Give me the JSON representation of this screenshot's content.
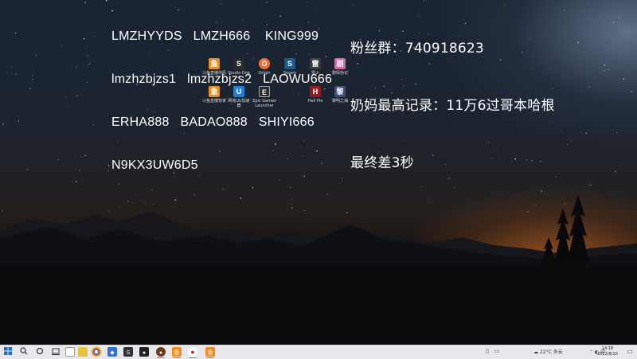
{
  "overlay": {
    "codes_lines": [
      "LMZHYYDS   LMZH666    KING999",
      "lmzhzbjzs1   lmzhzbjzs2   LAOWU666",
      "ERHA888   BADAO888   SHIYI666",
      "N9KX3UW6D5"
    ],
    "fan_group": "粉丝群：740918623",
    "record_line1": "奶妈最高记录：11万6过哥本哈根",
    "record_line2": "最终差3秒"
  },
  "desktop_icons": [
    {
      "label": "斗鱼直播伴侣",
      "icon": "douyu-icon",
      "color": "#f08c1e",
      "glyph": "鱼"
    },
    {
      "label": "Studio One 4",
      "icon": "studio-one-icon",
      "color": "#2b2b2b",
      "glyph": "S"
    },
    {
      "label": "Origin",
      "icon": "origin-icon",
      "color": "#f56c2d",
      "glyph": "O"
    },
    {
      "label": "Steam",
      "icon": "steam-icon",
      "color": "#1b5a8a",
      "glyph": "S"
    },
    {
      "label": "雷火",
      "icon": "leihuo-icon",
      "color": "#3a3a3a",
      "glyph": "雷"
    },
    {
      "label": "剧情伪记",
      "icon": "game-icon",
      "color": "#d46ba0",
      "glyph": "剧"
    },
    {
      "label": "斗鱼直播管家",
      "icon": "douyu-manager-icon",
      "color": "#f08c1e",
      "glyph": "鱼"
    },
    {
      "label": "网易UU加速器",
      "icon": "uu-accelerator-icon",
      "color": "#1e7fd6",
      "glyph": "U"
    },
    {
      "label": "Epic Games Launcher",
      "icon": "epic-games-icon",
      "color": "#2a2a2a",
      "glyph": "E"
    },
    {
      "label": "Hell Pie",
      "icon": "hell-pie-icon",
      "color": "#8a1f1f",
      "glyph": "H"
    },
    {
      "label": "黎明之海",
      "icon": "sea-of-dawn-icon",
      "color": "#3d4f7a",
      "glyph": "黎"
    }
  ],
  "taskbar": {
    "weather": "☁ 22°C  多云",
    "ime": "⌃ ◐ 中",
    "time": "14:18",
    "date": "2022/8/10"
  },
  "colors": {
    "taskbar_bg": "#e6e8ec",
    "overlay_text": "#ffffff"
  }
}
